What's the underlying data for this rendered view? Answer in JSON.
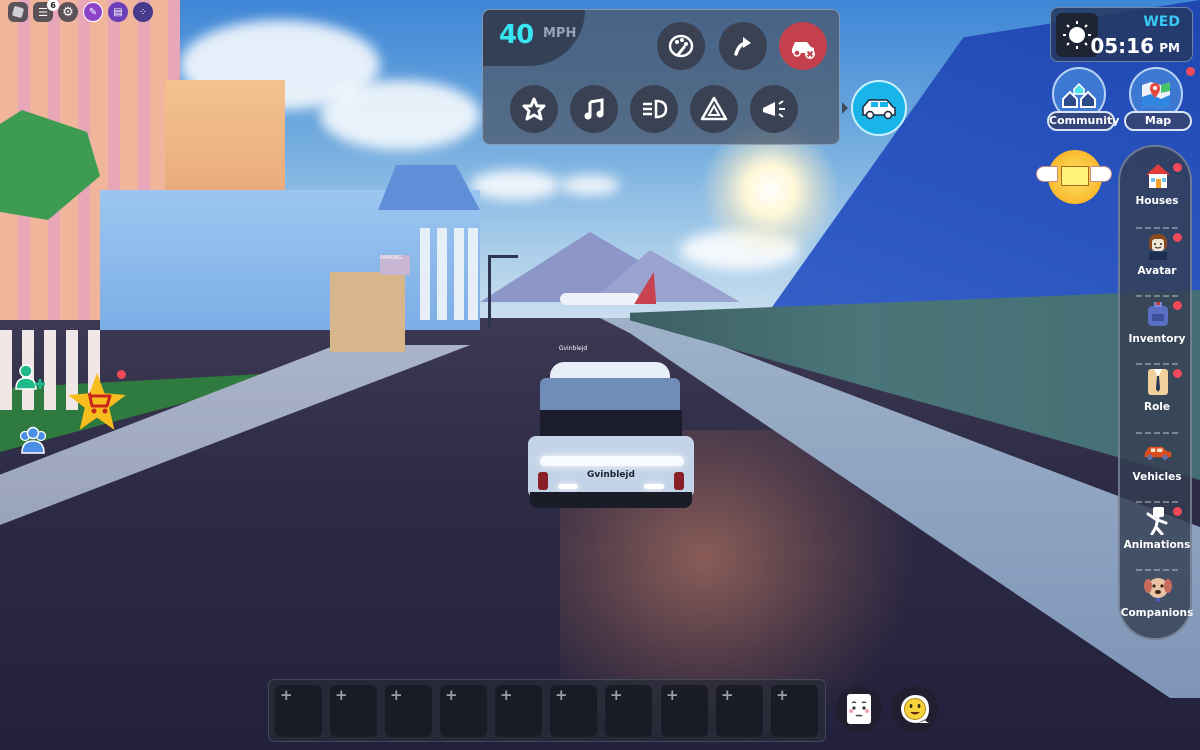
{
  "topbar": {
    "roblox_menu": "roblox-menu",
    "chat_badge": "6",
    "settings": "settings",
    "icons": [
      "roblox-logo-icon",
      "chat-icon",
      "gear-icon",
      "edit-chat-icon",
      "info-card-icon",
      "apps-grid-icon"
    ]
  },
  "vehicle_panel": {
    "speed": "40",
    "speed_unit": "MPH",
    "buttons_row1": [
      "paint-palette-icon",
      "flip-arrow-icon",
      "despawn-car-icon"
    ],
    "buttons_row2": [
      "star-icon",
      "music-note-icon",
      "headlight-icon",
      "hazard-icon",
      "horn-icon"
    ],
    "accent_color": "#37e6f2",
    "despawn_color": "#c5404d",
    "toggle_color": "#19b4ea"
  },
  "clock": {
    "day": "WED",
    "time": "05:16",
    "ampm": "PM",
    "icon": "sun-icon"
  },
  "top_right_buttons": [
    {
      "label": "Community",
      "icon": "community-houses-icon",
      "notification": false
    },
    {
      "label": "Map",
      "icon": "map-icon",
      "notification": true
    }
  ],
  "mail": {
    "icon": "winged-mail-icon"
  },
  "sidebar": {
    "items": [
      {
        "label": "Houses",
        "icon": "house-icon",
        "notification": true
      },
      {
        "label": "Avatar",
        "icon": "avatar-icon",
        "notification": true
      },
      {
        "label": "Inventory",
        "icon": "backpack-icon",
        "notification": true
      },
      {
        "label": "Role",
        "icon": "suit-icon",
        "notification": true
      },
      {
        "label": "Vehicles",
        "icon": "car-icon",
        "notification": false
      },
      {
        "label": "Animations",
        "icon": "dance-icon",
        "notification": true
      },
      {
        "label": "Companions",
        "icon": "dog-icon",
        "notification": false
      }
    ]
  },
  "left_buttons": [
    {
      "name": "add-friend",
      "icon": "add-friend-icon"
    },
    {
      "name": "shop",
      "icon": "shopping-cart-icon",
      "notification": true
    },
    {
      "name": "friends",
      "icon": "friends-icon"
    }
  ],
  "hotbar": {
    "slots": [
      "+",
      "+",
      "+",
      "+",
      "+",
      "+",
      "+",
      "+",
      "+",
      "+"
    ],
    "emotes_button": "emote-face-icon",
    "chat_bubble_button": "smiley-bubble-icon"
  },
  "world": {
    "player_name_tag": "Gvinblejd",
    "license_plate": "Gvinblejd",
    "parking_sign": "PARKING"
  }
}
